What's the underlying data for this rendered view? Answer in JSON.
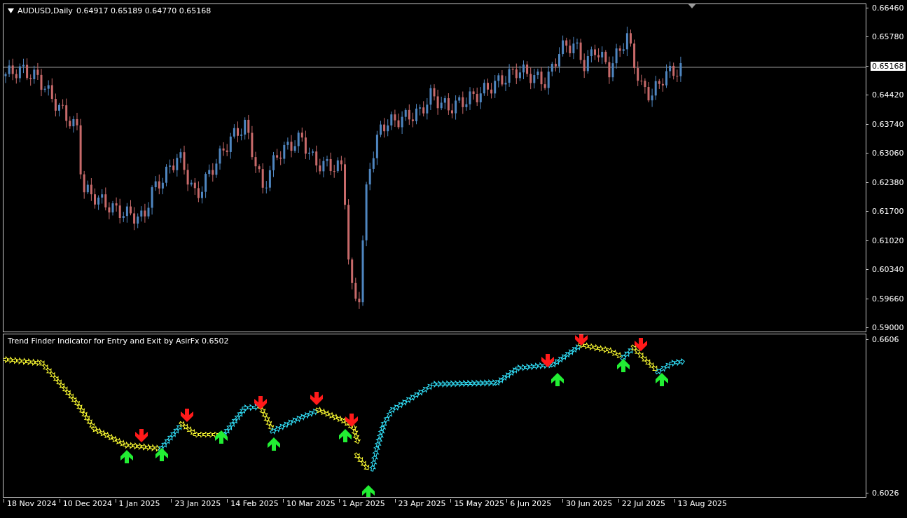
{
  "chart": {
    "symbol": "AUDUSD,Daily",
    "ohlc": "0.64917 0.65189 0.64770 0.65168",
    "price_axis": [
      {
        "kind": "tick",
        "text": "0.66460"
      },
      {
        "kind": "tick",
        "text": "0.65780"
      },
      {
        "kind": "current",
        "text": "0.65168"
      },
      {
        "kind": "tick",
        "text": "0.64420"
      },
      {
        "kind": "tick",
        "text": "0.63740"
      },
      {
        "kind": "tick",
        "text": "0.63060"
      },
      {
        "kind": "tick",
        "text": "0.62380"
      },
      {
        "kind": "tick",
        "text": "0.61700"
      },
      {
        "kind": "tick",
        "text": "0.61020"
      },
      {
        "kind": "tick",
        "text": "0.60340"
      },
      {
        "kind": "tick",
        "text": "0.59660"
      },
      {
        "kind": "tick",
        "text": "0.59000"
      }
    ]
  },
  "indicator": {
    "title": "Trend Finder Indicator for Entry and Exit by AsirFx 0.6502",
    "axis": [
      "0.6606",
      "0.6026"
    ]
  },
  "time_axis": [
    "18 Nov 2024",
    "10 Dec 2024",
    "1 Jan 2025",
    "23 Jan 2025",
    "14 Feb 2025",
    "10 Mar 2025",
    "1 Apr 2025",
    "23 Apr 2025",
    "15 May 2025",
    "6 Jun 2025",
    "30 Jun 2025",
    "22 Jul 2025",
    "13 Aug 2025"
  ]
}
